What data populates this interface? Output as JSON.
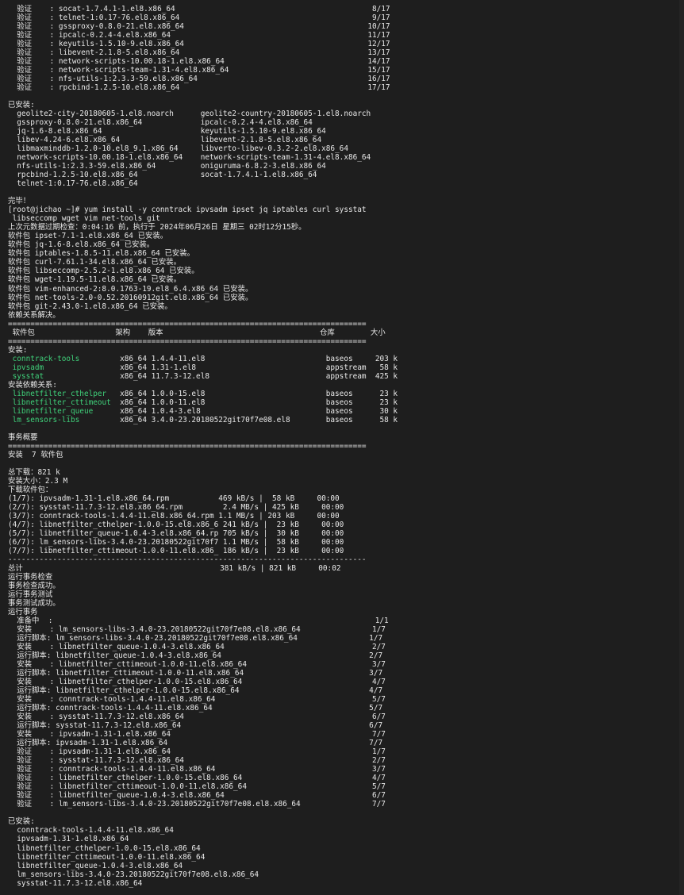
{
  "terminal": {
    "accent_green": "#3fd17a",
    "lines": [
      {
        "t": "  验证    : socat-1.7.4.1-1.el8.x86_64                                            8/17"
      },
      {
        "t": "  验证    : telnet-1:0.17-76.el8.x86_64                                           9/17"
      },
      {
        "t": "  验证    : gssproxy-0.8.0-21.el8.x86_64                                         10/17"
      },
      {
        "t": "  验证    : ipcalc-0.2.4-4.el8.x86_64                                            11/17"
      },
      {
        "t": "  验证    : keyutils-1.5.10-9.el8.x86_64                                         12/17"
      },
      {
        "t": "  验证    : libevent-2.1.8-5.el8.x86_64                                          13/17"
      },
      {
        "t": "  验证    : network-scripts-10.00.18-1.el8.x86_64                                14/17"
      },
      {
        "t": "  验证    : network-scripts-team-1.31-4.el8.x86_64                               15/17"
      },
      {
        "t": "  验证    : nfs-utils-1:2.3.3-59.el8.x86_64                                      16/17"
      },
      {
        "t": "  验证    : rpcbind-1.2.5-10.el8.x86_64                                          17/17"
      },
      {
        "t": ""
      },
      {
        "t": "已安装:"
      },
      {
        "t": "  geolite2-city-20180605-1.el8.noarch      geolite2-country-20180605-1.el8.noarch"
      },
      {
        "t": "  gssproxy-0.8.0-21.el8.x86_64             ipcalc-0.2.4-4.el8.x86_64"
      },
      {
        "t": "  jq-1.6-8.el8.x86_64                      keyutils-1.5.10-9.el8.x86_64"
      },
      {
        "t": "  libev-4.24-6.el8.x86_64                  libevent-2.1.8-5.el8.x86_64"
      },
      {
        "t": "  libmaxminddb-1.2.0-10.el8_9.1.x86_64     libverto-libev-0.3.2-2.el8.x86_64"
      },
      {
        "t": "  network-scripts-10.00.18-1.el8.x86_64    network-scripts-team-1.31-4.el8.x86_64"
      },
      {
        "t": "  nfs-utils-1:2.3.3-59.el8.x86_64          oniguruma-6.8.2-3.el8.x86_64"
      },
      {
        "t": "  rpcbind-1.2.5-10.el8.x86_64              socat-1.7.4.1-1.el8.x86_64"
      },
      {
        "t": "  telnet-1:0.17-76.el8.x86_64"
      },
      {
        "t": ""
      },
      {
        "t": "完毕！"
      },
      {
        "t": "[root@jichao ~]# yum install -y conntrack ipvsadm ipset jq iptables curl sysstat"
      },
      {
        "t": " libseccomp wget vim net-tools git"
      },
      {
        "t": "上次元数据过期检查：0:04:16 前，执行于 2024年06月26日 星期三 02时12分15秒。"
      },
      {
        "t": "软件包 ipset-7.1-1.el8.x86_64 已安装。"
      },
      {
        "t": "软件包 jq-1.6-8.el8.x86_64 已安装。"
      },
      {
        "t": "软件包 iptables-1.8.5-11.el8.x86_64 已安装。"
      },
      {
        "t": "软件包 curl-7.61.1-34.el8.x86_64 已安装。"
      },
      {
        "t": "软件包 libseccomp-2.5.2-1.el8.x86_64 已安装。"
      },
      {
        "t": "软件包 wget-1.19.5-11.el8.x86_64 已安装。"
      },
      {
        "t": "软件包 vim-enhanced-2:8.0.1763-19.el8_6.4.x86_64 已安装。"
      },
      {
        "t": "软件包 net-tools-2.0-0.52.20160912git.el8.x86_64 已安装。"
      },
      {
        "t": "软件包 git-2.43.0-1.el8.x86_64 已安装。"
      },
      {
        "t": "依赖关系解决。"
      },
      {
        "t": "================================================================================"
      },
      {
        "t": " 软件包                  架构    版本                                   仓库        大小"
      },
      {
        "t": "================================================================================"
      },
      {
        "t": "安装:"
      },
      {
        "t": " conntrack-tools         x86_64 1.4.4-11.el8                           baseos     203 k",
        "green": " conntrack-tools"
      },
      {
        "t": " ipvsadm                 x86_64 1.31-1.el8                             appstream   58 k",
        "green": " ipvsadm"
      },
      {
        "t": " sysstat                 x86_64 11.7.3-12.el8                          appstream  425 k",
        "green": " sysstat"
      },
      {
        "t": "安装依赖关系:"
      },
      {
        "t": " libnetfilter_cthelper   x86_64 1.0.0-15.el8                           baseos      23 k",
        "green": " libnetfilter_cthelper"
      },
      {
        "t": " libnetfilter_cttimeout  x86_64 1.0.0-11.el8                           baseos      23 k",
        "green": " libnetfilter_cttimeout"
      },
      {
        "t": " libnetfilter_queue      x86_64 1.0.4-3.el8                            baseos      30 k",
        "green": " libnetfilter_queue"
      },
      {
        "t": " lm_sensors-libs         x86_64 3.4.0-23.20180522git70f7e08.el8        baseos      58 k",
        "green": " lm_sensors-libs"
      },
      {
        "t": ""
      },
      {
        "t": "事务概要"
      },
      {
        "t": "================================================================================"
      },
      {
        "t": "安装  7 软件包"
      },
      {
        "t": ""
      },
      {
        "t": "总下载：821 k"
      },
      {
        "t": "安装大小：2.3 M"
      },
      {
        "t": "下载软件包："
      },
      {
        "t": "(1/7): ipvsadm-1.31-1.el8.x86_64.rpm           469 kB/s |  58 kB     00:00"
      },
      {
        "t": "(2/7): sysstat-11.7.3-12.el8.x86_64.rpm         2.4 MB/s | 425 kB     00:00"
      },
      {
        "t": "(3/7): conntrack-tools-1.4.4-11.el8.x86_64.rpm 1.1 MB/s | 203 kB     00:00"
      },
      {
        "t": "(4/7): libnetfilter_cthelper-1.0.0-15.el8.x86_6 241 kB/s |  23 kB     00:00"
      },
      {
        "t": "(5/7): libnetfilter_queue-1.0.4-3.el8.x86_64.rp 705 kB/s |  30 kB     00:00"
      },
      {
        "t": "(6/7): lm_sensors-libs-3.4.0-23.20180522git70f7 1.1 MB/s |  58 kB     00:00"
      },
      {
        "t": "(7/7): libnetfilter_cttimeout-1.0.0-11.el8.x86_ 186 kB/s |  23 kB     00:00"
      },
      {
        "t": "--------------------------------------------------------------------------------"
      },
      {
        "t": "总计                                            381 kB/s | 821 kB     00:02"
      },
      {
        "t": "运行事务检查"
      },
      {
        "t": "事务检查成功。"
      },
      {
        "t": "运行事务测试"
      },
      {
        "t": "事务测试成功。"
      },
      {
        "t": "运行事务"
      },
      {
        "t": "  准备中  :                                                                        1/1"
      },
      {
        "t": "  安装    : lm_sensors-libs-3.4.0-23.20180522git70f7e08.el8.x86_64                1/7"
      },
      {
        "t": "  运行脚本: lm_sensors-libs-3.4.0-23.20180522git70f7e08.el8.x86_64                1/7"
      },
      {
        "t": "  安装    : libnetfilter_queue-1.0.4-3.el8.x86_64                                 2/7"
      },
      {
        "t": "  运行脚本: libnetfilter_queue-1.0.4-3.el8.x86_64                                 2/7"
      },
      {
        "t": "  安装    : libnetfilter_cttimeout-1.0.0-11.el8.x86_64                            3/7"
      },
      {
        "t": "  运行脚本: libnetfilter_cttimeout-1.0.0-11.el8.x86_64                            3/7"
      },
      {
        "t": "  安装    : libnetfilter_cthelper-1.0.0-15.el8.x86_64                             4/7"
      },
      {
        "t": "  运行脚本: libnetfilter_cthelper-1.0.0-15.el8.x86_64                             4/7"
      },
      {
        "t": "  安装    : conntrack-tools-1.4.4-11.el8.x86_64                                   5/7"
      },
      {
        "t": "  运行脚本: conntrack-tools-1.4.4-11.el8.x86_64                                   5/7"
      },
      {
        "t": "  安装    : sysstat-11.7.3-12.el8.x86_64                                          6/7"
      },
      {
        "t": "  运行脚本: sysstat-11.7.3-12.el8.x86_64                                          6/7"
      },
      {
        "t": "  安装    : ipvsadm-1.31-1.el8.x86_64                                             7/7"
      },
      {
        "t": "  运行脚本: ipvsadm-1.31-1.el8.x86_64                                             7/7"
      },
      {
        "t": "  验证    : ipvsadm-1.31-1.el8.x86_64                                             1/7"
      },
      {
        "t": "  验证    : sysstat-11.7.3-12.el8.x86_64                                          2/7"
      },
      {
        "t": "  验证    : conntrack-tools-1.4.4-11.el8.x86_64                                   3/7"
      },
      {
        "t": "  验证    : libnetfilter_cthelper-1.0.0-15.el8.x86_64                             4/7"
      },
      {
        "t": "  验证    : libnetfilter_cttimeout-1.0.0-11.el8.x86_64                            5/7"
      },
      {
        "t": "  验证    : libnetfilter_queue-1.0.4-3.el8.x86_64                                 6/7"
      },
      {
        "t": "  验证    : lm_sensors-libs-3.4.0-23.20180522git70f7e08.el8.x86_64                7/7"
      },
      {
        "t": ""
      },
      {
        "t": "已安装:"
      },
      {
        "t": "  conntrack-tools-1.4.4-11.el8.x86_64"
      },
      {
        "t": "  ipvsadm-1.31-1.el8.x86_64"
      },
      {
        "t": "  libnetfilter_cthelper-1.0.0-15.el8.x86_64"
      },
      {
        "t": "  libnetfilter_cttimeout-1.0.0-11.el8.x86_64"
      },
      {
        "t": "  libnetfilter_queue-1.0.4-3.el8.x86_64"
      },
      {
        "t": "  lm_sensors-libs-3.4.0-23.20180522git70f7e08.el8.x86_64"
      },
      {
        "t": "  sysstat-11.7.3-12.el8.x86_64"
      }
    ]
  }
}
